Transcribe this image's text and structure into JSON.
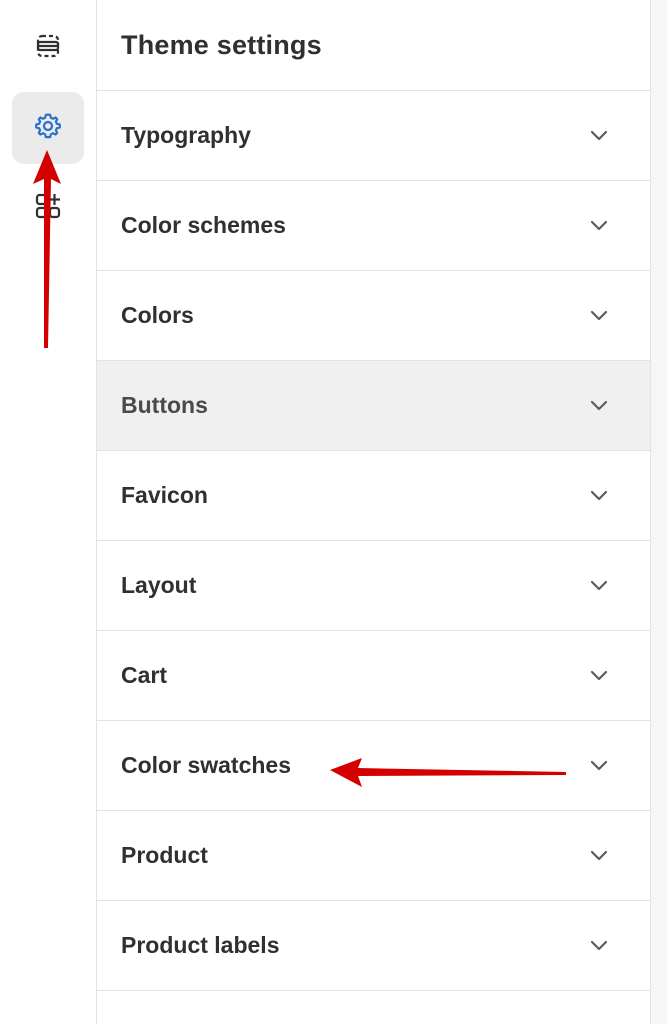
{
  "panel": {
    "title": "Theme settings"
  },
  "rail": {
    "items": [
      {
        "name": "sections",
        "icon": "sections-icon"
      },
      {
        "name": "theme-settings",
        "icon": "gear-icon",
        "active": true
      },
      {
        "name": "apps",
        "icon": "apps-add-icon"
      }
    ],
    "accent": "#2c6ecb"
  },
  "settings": {
    "items": [
      {
        "label": "Typography"
      },
      {
        "label": "Color schemes"
      },
      {
        "label": "Colors"
      },
      {
        "label": "Buttons"
      },
      {
        "label": "Favicon"
      },
      {
        "label": "Layout"
      },
      {
        "label": "Cart"
      },
      {
        "label": "Color swatches"
      },
      {
        "label": "Product"
      },
      {
        "label": "Product labels"
      }
    ]
  },
  "annotations": {
    "color": "#d40000"
  }
}
